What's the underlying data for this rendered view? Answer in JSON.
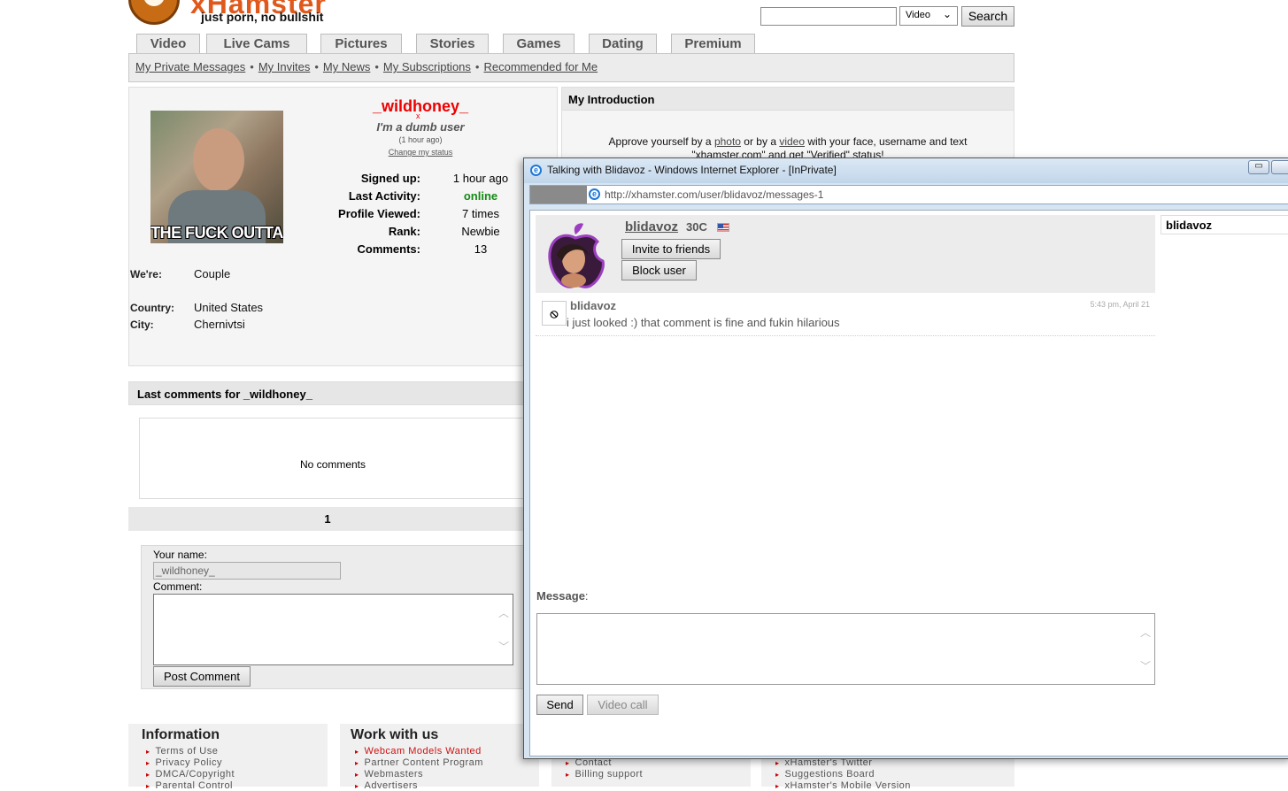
{
  "header": {
    "logo_text": "xHamster",
    "logo_tagline": "just porn, no bullshit",
    "search": {
      "value": "",
      "select_value": "Video",
      "button_label": "Search"
    }
  },
  "tabs": [
    {
      "label": "Video"
    },
    {
      "label": "Live Cams"
    },
    {
      "label": "Pictures"
    },
    {
      "label": "Stories"
    },
    {
      "label": "Games"
    },
    {
      "label": "Dating"
    },
    {
      "label": "Premium"
    }
  ],
  "subnav": [
    {
      "label": "My Private Messages"
    },
    {
      "label": "My Invites"
    },
    {
      "label": "My News"
    },
    {
      "label": "My Subscriptions"
    },
    {
      "label": "Recommended for Me"
    }
  ],
  "subnav_separator": "•",
  "profile": {
    "avatar_caption": "THE FUCK OUTTA",
    "username": "_wildhoney_",
    "status_marker": "x",
    "status_text": "I'm a dumb user",
    "status_time": "(1 hour ago)",
    "change_status": "Change my status",
    "stats": [
      {
        "label": "Signed up:",
        "value": "1 hour ago"
      },
      {
        "label": "Last Activity:",
        "value": "online"
      },
      {
        "label": "Profile Viewed:",
        "value": "7 times"
      },
      {
        "label": "Rank:",
        "value": "Newbie"
      },
      {
        "label": "Comments:",
        "value": "13"
      }
    ],
    "info": [
      {
        "label": "We're:",
        "value": "Couple"
      },
      {
        "label": "Country:",
        "value": "United States"
      },
      {
        "label": "City:",
        "value": "Chernivtsi"
      }
    ],
    "online_color": "#138a13"
  },
  "intro": {
    "title": "My Introduction",
    "line1_pre": "Approve yourself by a ",
    "photo_link": "photo",
    "line1_mid": " or by a ",
    "video_link": "video",
    "line1_post": " with your face, username and text",
    "line2": "\"xhamster.com\" and get \"Verified\" status!"
  },
  "comments": {
    "title": "Last comments for _wildhoney_",
    "empty_text": "No comments",
    "page": "1",
    "name_label": "Your name:",
    "name_value": "_wildhoney_",
    "comment_label": "Comment:",
    "post_button": "Post Comment"
  },
  "footer": {
    "columns": [
      {
        "title": "Information",
        "links": [
          "Terms of Use",
          "Privacy Policy",
          "DMCA/Copyright",
          "Parental Control"
        ]
      },
      {
        "title": "Work with us",
        "links": [
          "Webcam Models Wanted",
          "Partner Content Program",
          "Webmasters",
          "Advertisers"
        ]
      },
      {
        "title": "",
        "links": [
          "Contact",
          "Billing support"
        ]
      },
      {
        "title": "",
        "links": [
          "xHamster's Twitter",
          "Suggestions Board",
          "xHamster's Mobile Version"
        ]
      }
    ],
    "highlight_color": "#cc1111"
  },
  "popup": {
    "title": "Talking with Blidavoz - Windows Internet Explorer - [InPrivate]",
    "url": "http://xhamster.com/user/blidavoz/messages-1",
    "user": {
      "name": "blidavoz",
      "age": "30C",
      "invite_button": "Invite to friends",
      "block_button": "Block user"
    },
    "messages": [
      {
        "author": "blidavoz",
        "time": "5:43 pm, April 21",
        "text": "i just looked :) that comment is fine and fukin hilarious"
      }
    ],
    "sidebar_user": "blidavoz",
    "message_label": "Message",
    "message_colon": ":",
    "message_value": "",
    "send_button": "Send",
    "video_call_button": "Video call",
    "minimize_glyph": "▭"
  }
}
